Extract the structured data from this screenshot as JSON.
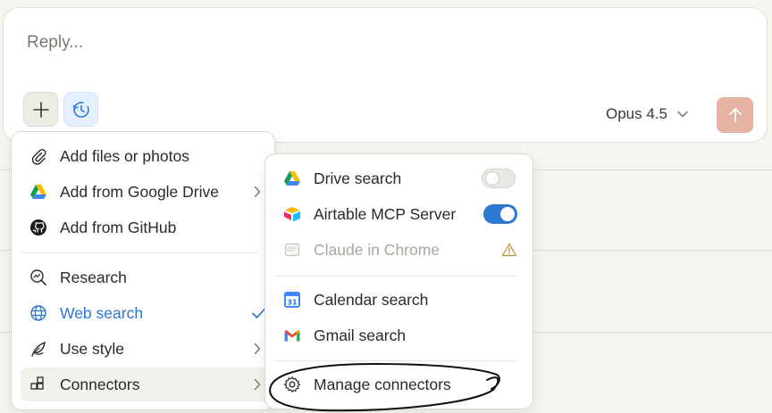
{
  "composer": {
    "placeholder": "Reply...",
    "model_label": "Opus 4.5"
  },
  "colors": {
    "accent_blue": "#2d76d2",
    "send_button": "#e6b3a2"
  },
  "attach_menu": {
    "items": [
      {
        "label": "Add files or photos",
        "icon": "paperclip-icon"
      },
      {
        "label": "Add from Google Drive",
        "icon": "google-drive-icon",
        "submenu": true
      },
      {
        "label": "Add from GitHub",
        "icon": "github-icon"
      },
      {
        "label": "Research",
        "icon": "research-icon"
      },
      {
        "label": "Web search",
        "icon": "globe-icon",
        "checked": true
      },
      {
        "label": "Use style",
        "icon": "feather-icon",
        "submenu": true
      },
      {
        "label": "Connectors",
        "icon": "connectors-icon",
        "submenu": true,
        "highlighted": true
      }
    ]
  },
  "connectors_menu": {
    "items": [
      {
        "label": "Drive search",
        "icon": "google-drive-icon",
        "toggle": "off"
      },
      {
        "label": "Airtable MCP Server",
        "icon": "airtable-icon",
        "toggle": "on"
      },
      {
        "label": "Claude in Chrome",
        "icon": "chrome-extension-icon",
        "disabled": true,
        "warning": true
      },
      {
        "label": "Calendar search",
        "icon": "google-calendar-icon"
      },
      {
        "label": "Gmail search",
        "icon": "gmail-icon"
      },
      {
        "label": "Manage connectors",
        "icon": "gear-icon",
        "annotated": true
      }
    ],
    "calendar_icon_text": "31"
  }
}
